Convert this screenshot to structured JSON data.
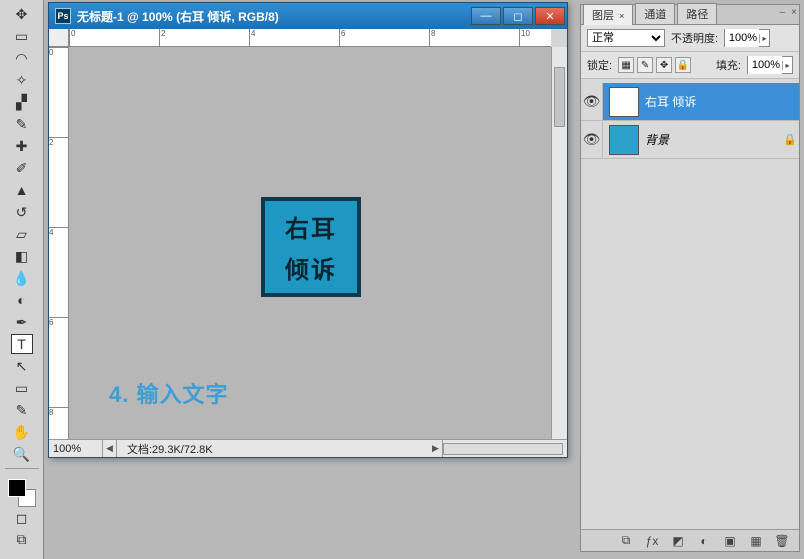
{
  "toolbox": {
    "tools": [
      {
        "name": "move-tool",
        "glyph": "✥"
      },
      {
        "name": "marquee-tool",
        "glyph": "▭"
      },
      {
        "name": "lasso-tool",
        "glyph": "◠"
      },
      {
        "name": "wand-tool",
        "glyph": "✧"
      },
      {
        "name": "crop-tool",
        "glyph": "▞"
      },
      {
        "name": "eyedropper-tool",
        "glyph": "✎"
      },
      {
        "name": "healing-tool",
        "glyph": "✚"
      },
      {
        "name": "brush-tool",
        "glyph": "✐"
      },
      {
        "name": "stamp-tool",
        "glyph": "▲"
      },
      {
        "name": "history-brush-tool",
        "glyph": "↺"
      },
      {
        "name": "eraser-tool",
        "glyph": "▱"
      },
      {
        "name": "gradient-tool",
        "glyph": "◧"
      },
      {
        "name": "blur-tool",
        "glyph": "💧"
      },
      {
        "name": "dodge-tool",
        "glyph": "◐"
      },
      {
        "name": "pen-tool",
        "glyph": "✒"
      },
      {
        "name": "type-tool",
        "glyph": "T",
        "selected": true
      },
      {
        "name": "path-select-tool",
        "glyph": "↖"
      },
      {
        "name": "shape-tool",
        "glyph": "▭"
      },
      {
        "name": "notes-tool",
        "glyph": "✎"
      },
      {
        "name": "hand-tool",
        "glyph": "✋"
      },
      {
        "name": "zoom-tool",
        "glyph": "🔍"
      }
    ]
  },
  "document": {
    "title": "无标题-1 @ 100% (右耳 倾诉, RGB/8)",
    "zoom": "100%",
    "docinfo": "文档:29.3K/72.8K",
    "ruler_ticks_h": [
      "0",
      "2",
      "4",
      "6",
      "8",
      "10"
    ],
    "ruler_ticks_v": [
      "0",
      "2",
      "4",
      "6",
      "8"
    ],
    "art": {
      "line1": "右耳",
      "line2": "倾诉"
    },
    "caption": "4. 输入文字"
  },
  "panel": {
    "tabs": {
      "layers": "图层",
      "channels": "通道",
      "paths": "路径"
    },
    "blend_mode": "正常",
    "opacity_label": "不透明度:",
    "opacity_value": "100%",
    "lock_label": "锁定:",
    "fill_label": "填充:",
    "fill_value": "100%",
    "layers": [
      {
        "name": "右耳 倾诉",
        "type": "text",
        "selected": true,
        "locked": false
      },
      {
        "name": "背景",
        "type": "bg",
        "selected": false,
        "locked": true
      }
    ],
    "close_x": "×"
  }
}
